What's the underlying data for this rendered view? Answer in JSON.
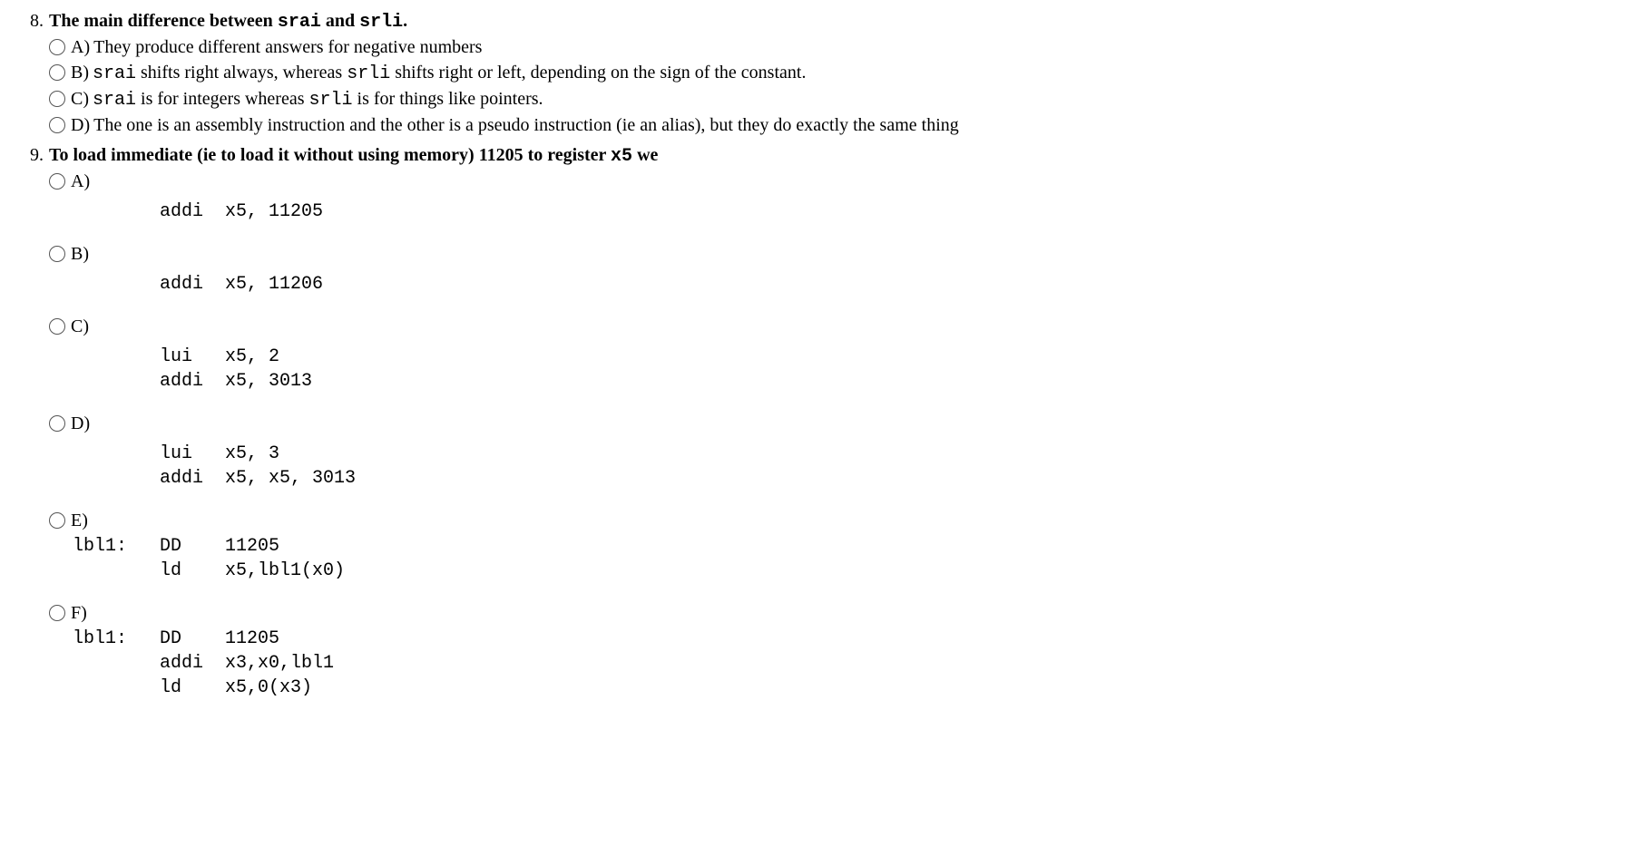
{
  "q8": {
    "number": "8.",
    "text_parts": [
      "The main difference between ",
      "srai",
      " and ",
      "srli",
      "."
    ],
    "options": {
      "a": {
        "label": "A)",
        "text": "They produce different answers for negative numbers"
      },
      "b": {
        "label": "B)",
        "parts": [
          "srai",
          " shifts right always, whereas ",
          "srli",
          " shifts right or left, depending on the sign of the constant."
        ]
      },
      "c": {
        "label": "C)",
        "parts": [
          "srai",
          " is for integers whereas ",
          "srli",
          " is for things like pointers."
        ]
      },
      "d": {
        "label": "D)",
        "text": "The one is an assembly instruction and the other is a pseudo instruction (ie an alias), but they do exactly the same thing"
      }
    }
  },
  "q9": {
    "number": "9.",
    "text_parts": [
      "To load immediate (ie to load it without using memory) 11205 to register ",
      "x5",
      " we"
    ],
    "options": {
      "a": {
        "label": "A)",
        "code": "        addi  x5, 11205"
      },
      "b": {
        "label": "B)",
        "code": "        addi  x5, 11206"
      },
      "c": {
        "label": "C)",
        "code": "        lui   x5, 2\n        addi  x5, 3013"
      },
      "d": {
        "label": "D)",
        "code": "        lui   x5, 3\n        addi  x5, x5, 3013"
      },
      "e": {
        "label": "E)",
        "code": "lbl1:   DD    11205\n        ld    x5,lbl1(x0)"
      },
      "f": {
        "label": "F)",
        "code": "lbl1:   DD    11205\n        addi  x3,x0,lbl1\n        ld    x5,0(x3)"
      }
    }
  }
}
